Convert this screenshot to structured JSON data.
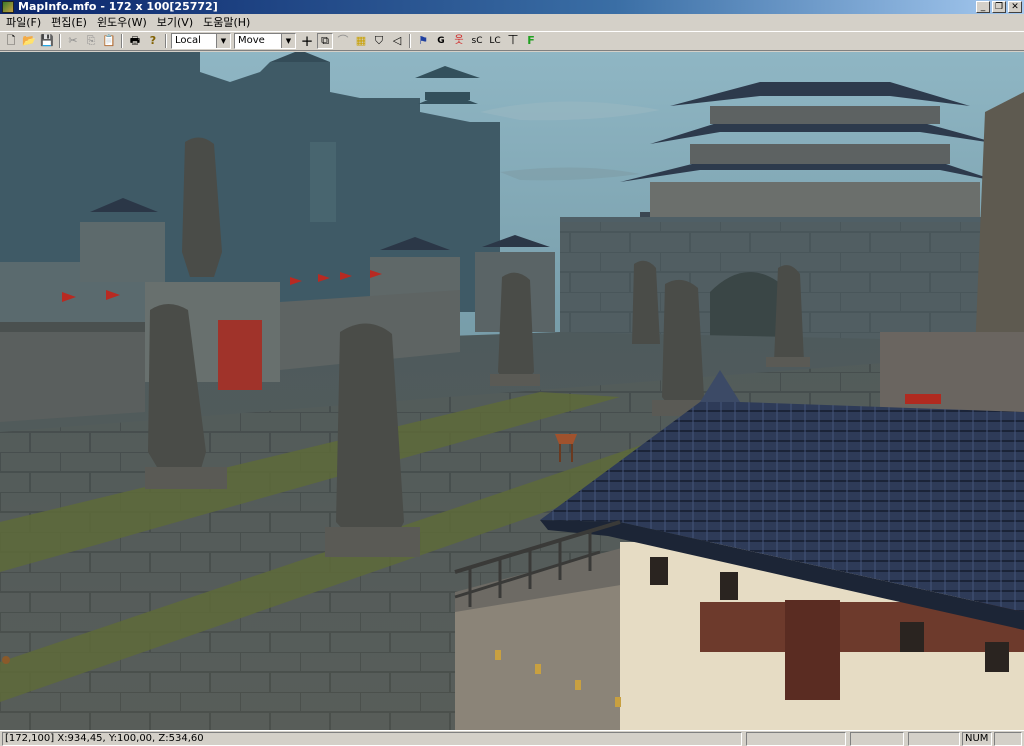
{
  "window": {
    "title": "MapInfo.mfo - 172 x 100[25772]",
    "minimize_glyph": "_",
    "restore_glyph": "❐",
    "close_glyph": "✕"
  },
  "menu": {
    "items": [
      {
        "label": "파일(F)"
      },
      {
        "label": "편집(E)"
      },
      {
        "label": "윈도우(W)"
      },
      {
        "label": "보기(V)"
      },
      {
        "label": "도움말(H)"
      }
    ]
  },
  "toolbar": {
    "coord_mode": "Local",
    "edit_mode": "Move",
    "glyphs": {
      "new": "🗋",
      "open": "📂",
      "save": "💾",
      "cut": "✂",
      "copy": "⎘",
      "paste": "📋",
      "print": "🖶",
      "help": "?",
      "crosshair": "+",
      "select_rect": "⧉",
      "bridge": "⌒",
      "grid": "▦",
      "shield": "⛉",
      "speaker": "◁",
      "flag": "⚑",
      "g": "G",
      "figure": "웃",
      "sc": "sC",
      "lc": "LC",
      "tbar": "⊤",
      "f": "F"
    },
    "arrow": "▼"
  },
  "status": {
    "coords": "[172,100] X:934,45, Y:100,00, Z:534,60",
    "num": "NUM"
  },
  "colors": {
    "title_start": "#0a246a",
    "title_end": "#a6caf0",
    "chrome": "#d4d0c8"
  }
}
